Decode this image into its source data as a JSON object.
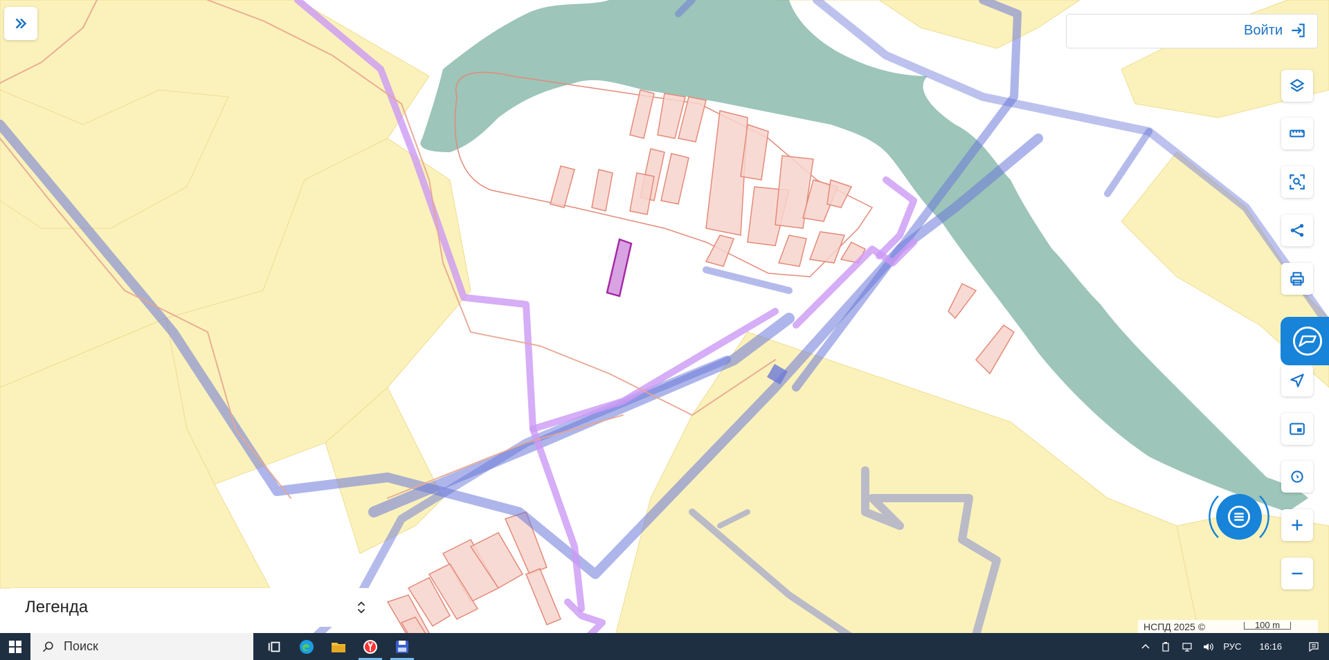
{
  "toolbar": {
    "login_label": "Войти"
  },
  "legend": {
    "title": "Легенда"
  },
  "map": {
    "attribution": "НСПД 2025 ©",
    "scale_label": "100 m"
  },
  "taskbar": {
    "search_placeholder": "Поиск",
    "language": "РУС",
    "time": "16:16"
  },
  "icons": {
    "expand": "double-chevron-right-icon",
    "login": "login-arrow-icon",
    "layers": "layers-icon",
    "ruler": "ruler-icon",
    "area_search": "area-search-icon",
    "share": "share-icon",
    "print": "print-icon",
    "feedback": "feedback-icon",
    "locate": "navigation-arrow-icon",
    "minimap": "minimap-icon",
    "geolocation": "geolocation-icon",
    "zoom_in": "plus-icon",
    "zoom_out": "minus-icon",
    "chat": "chat-icon"
  },
  "colors": {
    "accent": "#1783d9",
    "agricultural_zone": "#fbf2bb",
    "forest_zone": "#5c9e8a",
    "parcel": "#f7d4cc",
    "parcel_border": "#e38a78",
    "selected_parcel": "#d9a2e3",
    "selected_border": "#a52aa5",
    "boundary_blue": "#6a78d8",
    "boundary_purple": "#cc99f5"
  }
}
